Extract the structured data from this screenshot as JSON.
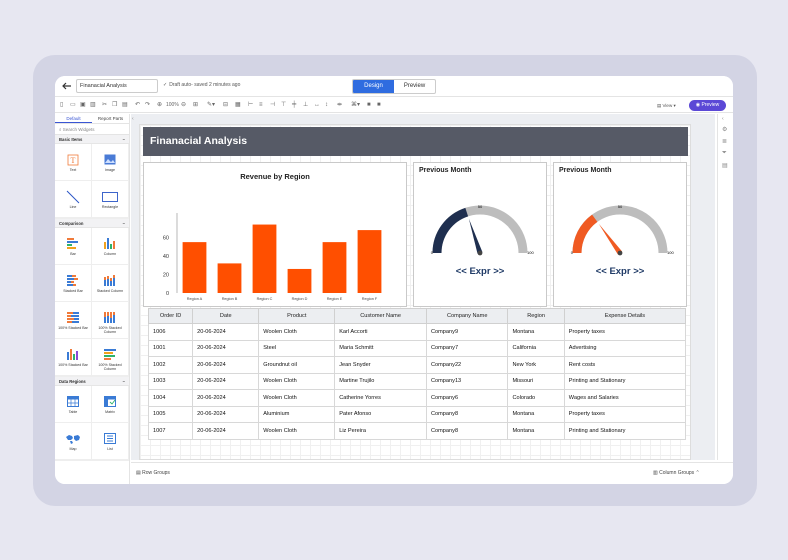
{
  "app": {
    "report_title": "Finanacial Analysis",
    "saved_status": "Draft auto- saved 2 minutes ago",
    "mode_design": "Design",
    "mode_preview": "Preview",
    "zoom": "100%",
    "view_label": "View",
    "preview_button": "Preview"
  },
  "sidebar": {
    "tab_default": "Default",
    "tab_report_parts": "Report Parts",
    "search_placeholder": "Search Widgets",
    "sections": [
      {
        "title": "Basic Items",
        "items": [
          "Text",
          "Image",
          "Line",
          "Rectangle"
        ]
      },
      {
        "title": "Comparison",
        "items": [
          "Bar",
          "Column",
          "Stacked Bar",
          "Stacked Column",
          "100% Stacked Bar",
          "100% Stacked Column",
          "100% Stacked Bar",
          "100% Stacked Column"
        ]
      },
      {
        "title": "Data Regions",
        "items": [
          "Table",
          "Matrix",
          "Map",
          "List"
        ]
      }
    ]
  },
  "report": {
    "header": "Finanacial Analysis",
    "gauges": [
      {
        "title": "Previous Month",
        "expr": "<< Expr >>",
        "min_label": "0",
        "mid_label": "50",
        "max_label": "100",
        "value": 40,
        "color": "#1f2f4f"
      },
      {
        "title": "Previous Month",
        "expr": "<< Expr >>",
        "min_label": "0",
        "mid_label": "50",
        "max_label": "100",
        "value": 30,
        "color": "#f05a22"
      }
    ],
    "table": {
      "columns": [
        "Order ID",
        "Date",
        "Product",
        "Customer Name",
        "Company Name",
        "Region",
        "Expense Details"
      ],
      "rows": [
        [
          "1006",
          "20-06-2024",
          "Woolen Cloth",
          "Karl Accorti",
          "Company9",
          "Montana",
          "Property taxes"
        ],
        [
          "1001",
          "20-06-2024",
          "Steel",
          "Maria Schmitt",
          "Company7",
          "California",
          "Advertising"
        ],
        [
          "1002",
          "20-06-2024",
          "Groundnut oil",
          "Jean Snyder",
          "Company22",
          "New York",
          "Rent costs"
        ],
        [
          "1003",
          "20-06-2024",
          "Woolen Cloth",
          "Martine Trujilo",
          "Company13",
          "Missouri",
          "Printing and Stationary"
        ],
        [
          "1004",
          "20-06-2024",
          "Woolen Cloth",
          "Catherine Yorres",
          "Company6",
          "Colorado",
          "Wages and Salaries"
        ],
        [
          "1005",
          "20-06-2024",
          "Aluminium",
          "Pater Afonso",
          "Company8",
          "Montana",
          "Property taxes"
        ],
        [
          "1007",
          "20-06-2024",
          "Woolen Cloth",
          "Liz Pereira",
          "Company8",
          "Montana",
          "Printing and Stationary"
        ]
      ]
    }
  },
  "footer": {
    "row_groups": "Row Groups",
    "column_groups": "Column Groups"
  },
  "chart_data": {
    "type": "bar",
    "title": "Revenue by Region",
    "categories": [
      "Region A",
      "Region B",
      "Region C",
      "Region D",
      "Region E",
      "Region F"
    ],
    "values": [
      55,
      32,
      74,
      26,
      55,
      68
    ],
    "ylim": [
      0,
      80
    ],
    "yticks": [
      0,
      20,
      40,
      60
    ],
    "color": "#ff4f00",
    "grid": false
  }
}
